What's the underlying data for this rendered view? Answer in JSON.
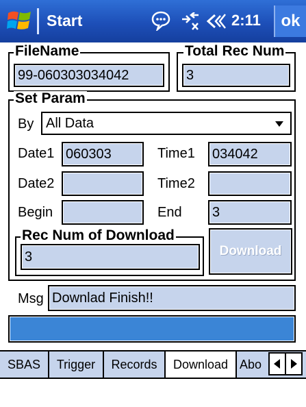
{
  "titlebar": {
    "title": "Start",
    "clock": "2:11",
    "ok_label": "ok",
    "icons": [
      "windows-logo-icon",
      "notification-icon",
      "connectivity-icon",
      "volume-icon"
    ]
  },
  "filename": {
    "group_label": "FileName",
    "value": "99-060303034042"
  },
  "total_rec": {
    "group_label": "Total Rec Num",
    "value": "3"
  },
  "set_param": {
    "group_label": "Set Param",
    "by_label": "By",
    "by_value": "All Data",
    "date1_label": "Date1",
    "date1_value": "060303",
    "time1_label": "Time1",
    "time1_value": "034042",
    "date2_label": "Date2",
    "date2_value": "",
    "time2_label": "Time2",
    "time2_value": "",
    "begin_label": "Begin",
    "begin_value": "",
    "end_label": "End",
    "end_value": "3",
    "rec_num_group_label": "Rec Num of Download",
    "rec_num_value": "3",
    "download_label": "Download"
  },
  "msg": {
    "label": "Msg",
    "value": "Downlad Finish!!"
  },
  "tabs": [
    {
      "label": "SBAS"
    },
    {
      "label": "Trigger"
    },
    {
      "label": "Records"
    },
    {
      "label": "Download"
    },
    {
      "label": "Abo"
    }
  ],
  "colors": {
    "titlebar": "#1d4fb8",
    "field_bg": "#c6d4ec",
    "progress": "#3b85d6"
  }
}
